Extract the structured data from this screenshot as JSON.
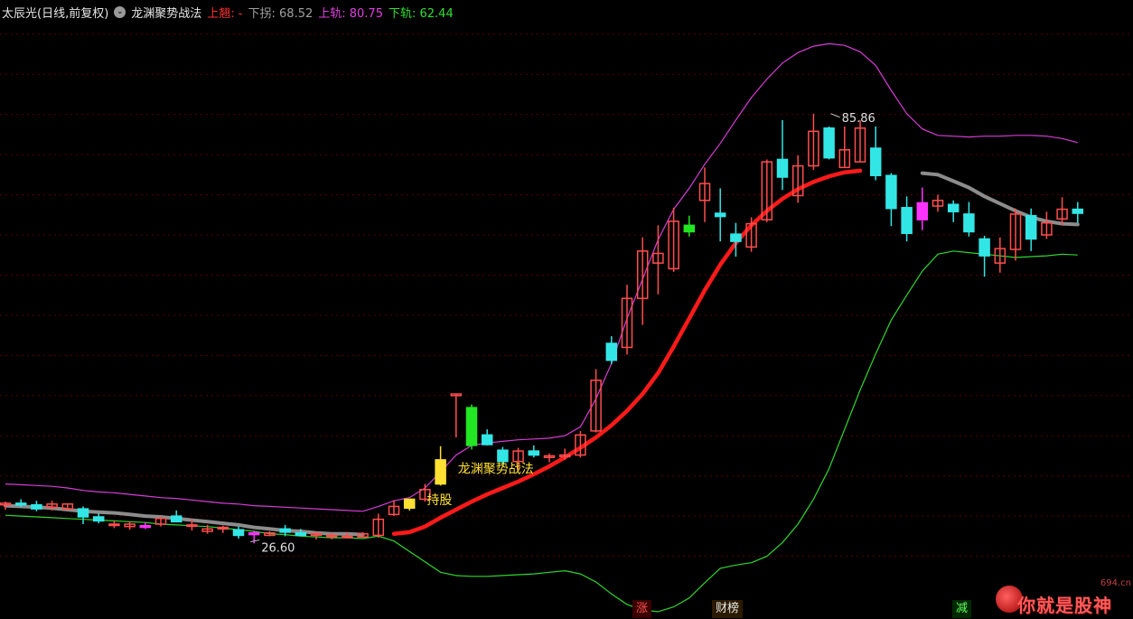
{
  "header": {
    "stock_label": "太辰光(日线,前复权)",
    "indicator_icon": "circle-chevron-icon",
    "indicator_name": "龙渊聚势战法",
    "up_line_label": "上翘: -",
    "down_turn_label": "下拐: 68.52",
    "upper_band_label": "上轨: 80.75",
    "lower_band_label": "下轨: 62.44"
  },
  "annotations": {
    "high_marker": "85.86",
    "low_marker": "26.60",
    "signal_text": "龙渊聚势战法",
    "hold_text": "持股"
  },
  "badges": {
    "zhang": "涨",
    "caibang": "财榜",
    "jian": "减"
  },
  "logo": {
    "site": "694.cn",
    "text": "你就是股神"
  },
  "colors": {
    "background": "#000000",
    "up_candle": "#ff4d4d",
    "down_candle": "#33e6e6",
    "hold_candle": "#ffe033",
    "upper_band": "#d63dd6",
    "lower_band": "#2ed62e",
    "trend_up": "#ff1a1a",
    "trend_gray": "#8c8c8c",
    "grid": "#5a0000"
  },
  "chart_data": {
    "type": "candlestick",
    "ylim": [
      20,
      92
    ],
    "grid": true,
    "candles": [
      {
        "o": 31.4,
        "h": 31.8,
        "l": 30.8,
        "c": 31.6,
        "k": "up"
      },
      {
        "o": 31.6,
        "h": 32.1,
        "l": 31.1,
        "c": 31.4,
        "k": "down"
      },
      {
        "o": 31.4,
        "h": 31.9,
        "l": 30.6,
        "c": 30.9,
        "k": "down"
      },
      {
        "o": 31.1,
        "h": 31.9,
        "l": 30.7,
        "c": 31.5,
        "k": "up"
      },
      {
        "o": 31.5,
        "h": 31.6,
        "l": 30.7,
        "c": 30.9,
        "k": "up"
      },
      {
        "o": 30.9,
        "h": 31.2,
        "l": 29.0,
        "c": 29.9,
        "k": "down"
      },
      {
        "o": 29.9,
        "h": 30.3,
        "l": 29.1,
        "c": 29.4,
        "k": "down"
      },
      {
        "o": 29.0,
        "h": 29.4,
        "l": 28.5,
        "c": 29.0,
        "k": "up"
      },
      {
        "o": 28.7,
        "h": 29.3,
        "l": 28.3,
        "c": 29.0,
        "k": "up"
      },
      {
        "o": 28.8,
        "h": 29.2,
        "l": 28.4,
        "c": 28.6,
        "k": "mag"
      },
      {
        "o": 29.0,
        "h": 29.9,
        "l": 28.7,
        "c": 29.7,
        "k": "up"
      },
      {
        "o": 30.0,
        "h": 30.7,
        "l": 29.4,
        "c": 29.3,
        "k": "down"
      },
      {
        "o": 28.9,
        "h": 29.6,
        "l": 28.2,
        "c": 28.8,
        "k": "up"
      },
      {
        "o": 28.4,
        "h": 28.9,
        "l": 27.8,
        "c": 28.1,
        "k": "up"
      },
      {
        "o": 28.4,
        "h": 28.8,
        "l": 27.9,
        "c": 28.6,
        "k": "up"
      },
      {
        "o": 28.3,
        "h": 28.7,
        "l": 27.2,
        "c": 27.6,
        "k": "down"
      },
      {
        "o": 27.7,
        "h": 28.2,
        "l": 26.6,
        "c": 27.9,
        "k": "mag"
      },
      {
        "o": 27.9,
        "h": 28.1,
        "l": 27.5,
        "c": 27.6,
        "k": "up"
      },
      {
        "o": 28.0,
        "h": 28.9,
        "l": 27.5,
        "c": 28.4,
        "k": "down"
      },
      {
        "o": 27.9,
        "h": 28.4,
        "l": 27.5,
        "c": 27.6,
        "k": "down"
      },
      {
        "o": 27.6,
        "h": 28.0,
        "l": 27.1,
        "c": 27.8,
        "k": "up"
      },
      {
        "o": 27.5,
        "h": 27.9,
        "l": 27.1,
        "c": 27.6,
        "k": "up"
      },
      {
        "o": 27.4,
        "h": 28.0,
        "l": 27.2,
        "c": 27.5,
        "k": "up"
      },
      {
        "o": 27.4,
        "h": 28.0,
        "l": 27.3,
        "c": 27.8,
        "k": "up"
      },
      {
        "o": 27.6,
        "h": 30.3,
        "l": 27.3,
        "c": 29.6,
        "k": "up"
      },
      {
        "o": 30.2,
        "h": 32.0,
        "l": 30.0,
        "c": 31.2,
        "k": "up"
      },
      {
        "o": 31.0,
        "h": 32.0,
        "l": 30.7,
        "c": 32.1,
        "k": "hold"
      },
      {
        "o": 32.1,
        "h": 34.0,
        "l": 31.8,
        "c": 33.3,
        "k": "up"
      },
      {
        "o": 34.0,
        "h": 38.7,
        "l": 33.8,
        "c": 37.0,
        "k": "hold"
      },
      {
        "o": 45.2,
        "h": 45.2,
        "l": 39.8,
        "c": 45.0,
        "k": "up"
      },
      {
        "o": 43.5,
        "h": 43.9,
        "l": 38.3,
        "c": 38.8,
        "k": "greenfill"
      },
      {
        "o": 40.1,
        "h": 40.8,
        "l": 38.8,
        "c": 38.9,
        "k": "down"
      },
      {
        "o": 38.2,
        "h": 38.6,
        "l": 36.4,
        "c": 36.8,
        "k": "down"
      },
      {
        "o": 36.8,
        "h": 38.5,
        "l": 35.8,
        "c": 38.1,
        "k": "up"
      },
      {
        "o": 38.1,
        "h": 38.8,
        "l": 37.3,
        "c": 37.6,
        "k": "down"
      },
      {
        "o": 37.3,
        "h": 37.8,
        "l": 36.7,
        "c": 37.5,
        "k": "up"
      },
      {
        "o": 37.4,
        "h": 38.4,
        "l": 37.0,
        "c": 37.6,
        "k": "up"
      },
      {
        "o": 37.6,
        "h": 40.6,
        "l": 37.3,
        "c": 40.1,
        "k": "up"
      },
      {
        "o": 40.6,
        "h": 48.3,
        "l": 40.4,
        "c": 46.9,
        "k": "up"
      },
      {
        "o": 51.5,
        "h": 52.4,
        "l": 48.9,
        "c": 49.4,
        "k": "down"
      },
      {
        "o": 51.0,
        "h": 58.8,
        "l": 50.1,
        "c": 57.1,
        "k": "up"
      },
      {
        "o": 57.1,
        "h": 64.7,
        "l": 53.8,
        "c": 63.0,
        "k": "up"
      },
      {
        "o": 61.5,
        "h": 66.2,
        "l": 57.6,
        "c": 62.7,
        "k": "up"
      },
      {
        "o": 60.8,
        "h": 68.4,
        "l": 60.4,
        "c": 66.7,
        "k": "up"
      },
      {
        "o": 66.2,
        "h": 67.4,
        "l": 64.8,
        "c": 65.4,
        "k": "greenfill"
      },
      {
        "o": 69.3,
        "h": 73.4,
        "l": 66.6,
        "c": 71.4,
        "k": "up"
      },
      {
        "o": 67.7,
        "h": 70.8,
        "l": 64.2,
        "c": 67.3,
        "k": "down"
      },
      {
        "o": 65.1,
        "h": 66.5,
        "l": 62.3,
        "c": 64.2,
        "k": "down"
      },
      {
        "o": 63.5,
        "h": 67.2,
        "l": 62.9,
        "c": 66.4,
        "k": "up"
      },
      {
        "o": 66.9,
        "h": 74.4,
        "l": 66.6,
        "c": 74.1,
        "k": "up"
      },
      {
        "o": 74.4,
        "h": 79.3,
        "l": 70.6,
        "c": 72.2,
        "k": "down"
      },
      {
        "o": 69.9,
        "h": 74.9,
        "l": 69.0,
        "c": 73.6,
        "k": "up"
      },
      {
        "o": 73.6,
        "h": 80.1,
        "l": 73.1,
        "c": 77.9,
        "k": "up"
      },
      {
        "o": 74.6,
        "h": 78.5,
        "l": 74.4,
        "c": 78.3,
        "k": "down"
      },
      {
        "o": 73.4,
        "h": 78.5,
        "l": 73.4,
        "c": 75.6,
        "k": "up"
      },
      {
        "o": 74.1,
        "h": 79.3,
        "l": 74.1,
        "c": 78.3,
        "k": "up"
      },
      {
        "o": 75.8,
        "h": 78.5,
        "l": 71.8,
        "c": 72.4,
        "k": "down"
      },
      {
        "o": 72.4,
        "h": 72.7,
        "l": 66.1,
        "c": 68.3,
        "k": "down"
      },
      {
        "o": 68.4,
        "h": 69.8,
        "l": 64.2,
        "c": 65.2,
        "k": "down"
      },
      {
        "o": 66.9,
        "h": 70.9,
        "l": 65.6,
        "c": 69.0,
        "k": "mag"
      },
      {
        "o": 68.6,
        "h": 70.0,
        "l": 67.9,
        "c": 69.3,
        "k": "up"
      },
      {
        "o": 68.8,
        "h": 69.3,
        "l": 66.6,
        "c": 67.9,
        "k": "down"
      },
      {
        "o": 67.6,
        "h": 69.1,
        "l": 64.8,
        "c": 65.4,
        "k": "down"
      },
      {
        "o": 64.5,
        "h": 64.9,
        "l": 59.8,
        "c": 62.4,
        "k": "down"
      },
      {
        "o": 61.5,
        "h": 64.7,
        "l": 60.3,
        "c": 63.3,
        "k": "up"
      },
      {
        "o": 63.2,
        "h": 68.3,
        "l": 61.8,
        "c": 67.6,
        "k": "up"
      },
      {
        "o": 67.4,
        "h": 68.3,
        "l": 63.0,
        "c": 64.5,
        "k": "down"
      },
      {
        "o": 65.0,
        "h": 67.9,
        "l": 64.5,
        "c": 66.5,
        "k": "up"
      },
      {
        "o": 67.0,
        "h": 69.7,
        "l": 66.2,
        "c": 68.2,
        "k": "up"
      },
      {
        "o": 67.7,
        "h": 69.1,
        "l": 66.5,
        "c": 68.2,
        "k": "down"
      }
    ],
    "upper_band": [
      34.0,
      33.9,
      33.8,
      33.7,
      33.5,
      33.2,
      33.0,
      32.9,
      32.7,
      32.5,
      32.3,
      32.2,
      32.0,
      31.8,
      31.6,
      31.5,
      31.3,
      31.2,
      31.1,
      31.0,
      30.9,
      30.8,
      30.7,
      30.6,
      31.2,
      31.9,
      32.3,
      33.5,
      35.5,
      37.6,
      38.8,
      39.1,
      39.3,
      39.5,
      39.6,
      39.7,
      40.0,
      41.1,
      44.6,
      49.0,
      54.6,
      59.5,
      64.4,
      68.2,
      70.8,
      73.8,
      76.4,
      79.3,
      82.1,
      84.4,
      86.4,
      87.7,
      88.5,
      88.8,
      88.6,
      87.8,
      86.1,
      83.0,
      80.1,
      78.2,
      77.4,
      77.3,
      77.2,
      77.3,
      77.3,
      77.4,
      77.4,
      77.3,
      77.0,
      76.5
    ],
    "lower_band": [
      30.1,
      30.0,
      29.9,
      29.8,
      29.7,
      29.6,
      29.5,
      29.4,
      29.3,
      29.2,
      29.0,
      28.9,
      28.8,
      28.7,
      28.5,
      28.3,
      28.1,
      27.8,
      27.7,
      27.5,
      27.4,
      27.3,
      27.3,
      27.2,
      27.5,
      26.9,
      25.6,
      24.3,
      23.0,
      22.6,
      22.5,
      22.5,
      22.6,
      22.7,
      22.8,
      23.0,
      23.2,
      22.8,
      21.8,
      20.3,
      19.0,
      18.3,
      18.1,
      18.7,
      19.8,
      21.7,
      23.5,
      23.9,
      24.2,
      25.0,
      26.7,
      29.0,
      32.1,
      35.9,
      40.8,
      45.7,
      50.2,
      54.4,
      57.5,
      60.5,
      62.6,
      63.0,
      62.8,
      62.6,
      62.4,
      62.2,
      62.3,
      62.4,
      62.6,
      62.5
    ],
    "trend_red": [
      null,
      null,
      null,
      null,
      null,
      null,
      null,
      null,
      null,
      null,
      null,
      null,
      null,
      null,
      null,
      null,
      null,
      null,
      null,
      null,
      null,
      null,
      null,
      null,
      null,
      27.8,
      28.0,
      28.7,
      29.8,
      30.8,
      31.8,
      32.7,
      33.5,
      34.3,
      35.2,
      36.2,
      37.3,
      38.5,
      39.8,
      41.3,
      43.1,
      45.2,
      47.8,
      51.1,
      54.6,
      58.1,
      61.3,
      64.0,
      66.2,
      68.0,
      69.5,
      70.7,
      71.6,
      72.3,
      72.8,
      73.0,
      null,
      null,
      null,
      null,
      null,
      null,
      null,
      null,
      null,
      null,
      null,
      null,
      null,
      null
    ],
    "trend_gray": [
      31.3,
      31.2,
      31.1,
      31.0,
      30.8,
      30.6,
      30.5,
      30.4,
      30.2,
      30.0,
      29.9,
      29.7,
      29.5,
      29.3,
      29.1,
      28.9,
      28.6,
      28.4,
      28.2,
      28.1,
      27.9,
      27.8,
      27.8,
      27.7,
      null,
      null,
      null,
      null,
      null,
      null,
      null,
      null,
      null,
      null,
      null,
      null,
      null,
      null,
      null,
      null,
      null,
      null,
      null,
      null,
      null,
      null,
      null,
      null,
      null,
      null,
      null,
      null,
      null,
      null,
      null,
      null,
      null,
      null,
      null,
      72.7,
      72.5,
      71.7,
      70.9,
      69.8,
      68.9,
      68.0,
      67.2,
      66.7,
      66.4,
      66.3
    ]
  }
}
